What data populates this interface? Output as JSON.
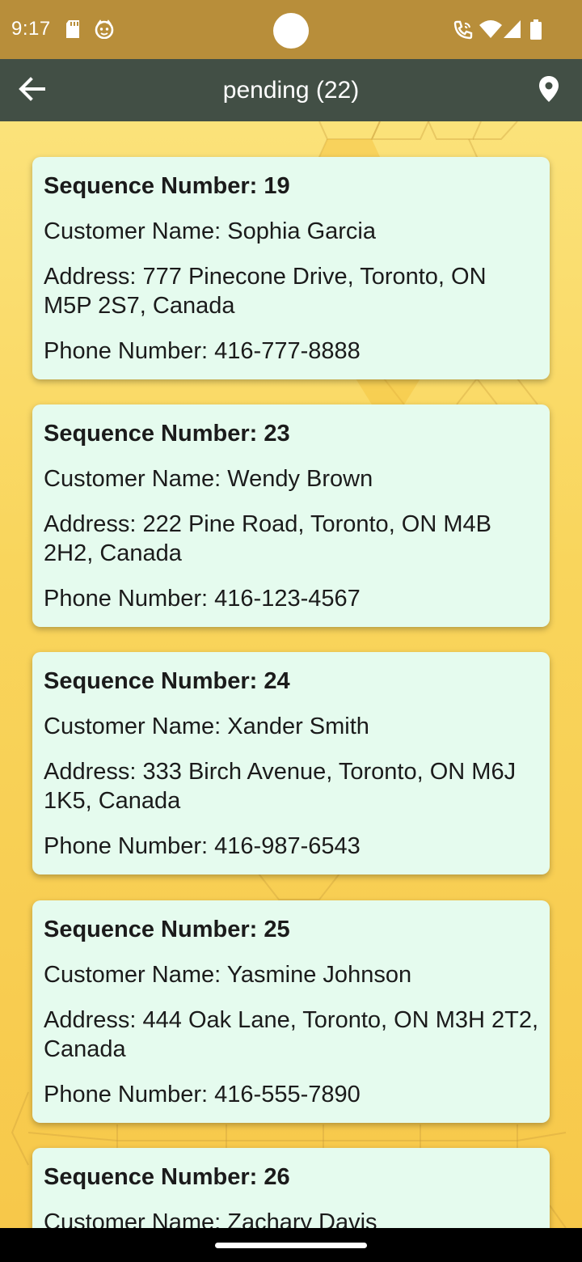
{
  "status_bar": {
    "time": "9:17",
    "icons_left": [
      "sd-card-icon",
      "face-icon"
    ],
    "icons_right": [
      "wifi-calling-icon",
      "wifi-icon",
      "signal-icon",
      "battery-icon"
    ],
    "background": "#b88e3a"
  },
  "app_bar": {
    "title": "pending (22)",
    "left_icon": "back-arrow-icon",
    "right_icon": "location-pin-icon",
    "background": "#424f45"
  },
  "cards": [
    {
      "sequence": "Sequence Number: 19",
      "customer": "Customer Name: Sophia Garcia",
      "address": "Address: 777 Pinecone Drive, Toronto, ON M5P 2S7, Canada",
      "phone": "Phone Number: 416-777-8888"
    },
    {
      "sequence": "Sequence Number: 23",
      "customer": "Customer Name: Wendy Brown",
      "address": "Address: 222 Pine Road, Toronto, ON M4B 2H2, Canada",
      "phone": "Phone Number: 416-123-4567"
    },
    {
      "sequence": "Sequence Number: 24",
      "customer": "Customer Name: Xander Smith",
      "address": "Address: 333 Birch Avenue, Toronto, ON M6J 1K5, Canada",
      "phone": "Phone Number: 416-987-6543"
    },
    {
      "sequence": "Sequence Number: 25",
      "customer": "Customer Name: Yasmine Johnson",
      "address": "Address: 444 Oak Lane, Toronto, ON M3H 2T2, Canada",
      "phone": "Phone Number: 416-555-7890"
    },
    {
      "sequence": "Sequence Number: 26",
      "customer": "Customer Name: Zachary Davis",
      "address": "",
      "phone": ""
    }
  ],
  "colors": {
    "card_background": "#e5fbee",
    "page_background": "#f9d55c"
  }
}
